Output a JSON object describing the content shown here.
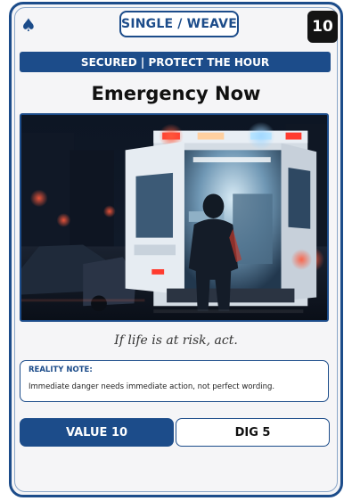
{
  "card": {
    "suit_icon": "spade-icon",
    "type": "SINGLE / WEAVE",
    "number": "10",
    "status": "SECURED | PROTECT THE HOUR",
    "title": "Emergency Now",
    "art_subject": "ambulance-rear-doors-at-night",
    "flavor": "If life is at risk, act.",
    "note": {
      "label": "REALITY NOTE:",
      "text": "Immediate danger needs immediate action, not perfect wording."
    },
    "value": "VALUE 10",
    "dig": "DIG 5"
  },
  "colors": {
    "accent": "#1c4c8a",
    "card_bg": "#f5f5f7",
    "number_box": "#141414"
  }
}
